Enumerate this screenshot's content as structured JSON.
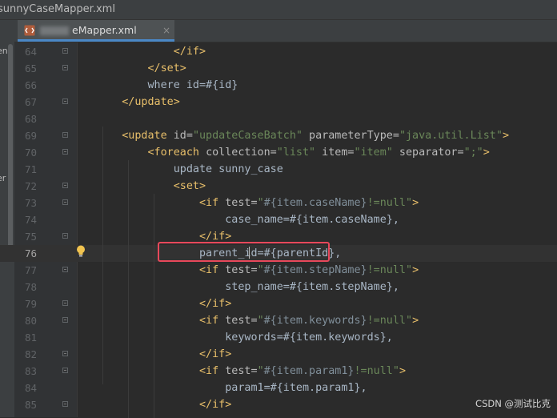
{
  "window": {
    "title": "sunnyCaseMapper.xml"
  },
  "left_panel": {
    "fragment_top": "ent",
    "fragment_mid": "er"
  },
  "tab": {
    "label_visible": "eMapper.xml",
    "icon": "xml-file-icon",
    "close": "×"
  },
  "editor": {
    "current_line": 76,
    "lines": [
      {
        "n": "64",
        "t": [
          {
            "c": "tag",
            "s": "            </if>"
          }
        ]
      },
      {
        "n": "65",
        "t": [
          {
            "c": "tag",
            "s": "        </set>"
          }
        ]
      },
      {
        "n": "66",
        "t": [
          {
            "c": "txt",
            "s": "        where id=#{id}"
          }
        ]
      },
      {
        "n": "67",
        "t": [
          {
            "c": "tag",
            "s": "    </update>"
          }
        ]
      },
      {
        "n": "68",
        "t": []
      },
      {
        "n": "69",
        "t": [
          {
            "c": "tag",
            "s": "    <update "
          },
          {
            "c": "attr",
            "s": "id="
          },
          {
            "c": "val",
            "s": "\"updateCaseBatch\""
          },
          {
            "c": "attr",
            "s": " parameterType="
          },
          {
            "c": "val",
            "s": "\"java.util.List\""
          },
          {
            "c": "tag",
            "s": ">"
          }
        ]
      },
      {
        "n": "70",
        "t": [
          {
            "c": "tag",
            "s": "        <foreach "
          },
          {
            "c": "attr",
            "s": "collection="
          },
          {
            "c": "val",
            "s": "\"list\""
          },
          {
            "c": "attr",
            "s": " item="
          },
          {
            "c": "val",
            "s": "\"item\""
          },
          {
            "c": "attr",
            "s": " separator="
          },
          {
            "c": "val",
            "s": "\";\""
          },
          {
            "c": "tag",
            "s": ">"
          }
        ]
      },
      {
        "n": "71",
        "t": [
          {
            "c": "txt",
            "s": "            update sunny_case"
          }
        ]
      },
      {
        "n": "72",
        "t": [
          {
            "c": "tag",
            "s": "            <set>"
          }
        ]
      },
      {
        "n": "73",
        "t": [
          {
            "c": "tag",
            "s": "                <if "
          },
          {
            "c": "attr",
            "s": "test="
          },
          {
            "c": "val",
            "s": "\""
          },
          {
            "c": "inner",
            "s": "#{item.caseName}"
          },
          {
            "c": "val",
            "s": "!=null\""
          },
          {
            "c": "tag",
            "s": ">"
          }
        ]
      },
      {
        "n": "74",
        "t": [
          {
            "c": "txt",
            "s": "                    case_name=#{item.caseName},"
          }
        ]
      },
      {
        "n": "75",
        "t": [
          {
            "c": "tag",
            "s": "                </if>"
          }
        ]
      },
      {
        "n": "76",
        "t": [
          {
            "c": "txt",
            "s": "                parent_id=#{parentId},"
          }
        ]
      },
      {
        "n": "77",
        "t": [
          {
            "c": "tag",
            "s": "                <if "
          },
          {
            "c": "attr",
            "s": "test="
          },
          {
            "c": "val",
            "s": "\""
          },
          {
            "c": "inner",
            "s": "#{item.stepName}"
          },
          {
            "c": "val",
            "s": "!=null\""
          },
          {
            "c": "tag",
            "s": ">"
          }
        ]
      },
      {
        "n": "78",
        "t": [
          {
            "c": "txt",
            "s": "                    step_name=#{item.stepName},"
          }
        ]
      },
      {
        "n": "79",
        "t": [
          {
            "c": "tag",
            "s": "                </if>"
          }
        ]
      },
      {
        "n": "80",
        "t": [
          {
            "c": "tag",
            "s": "                <if "
          },
          {
            "c": "attr",
            "s": "test="
          },
          {
            "c": "val",
            "s": "\""
          },
          {
            "c": "inner",
            "s": "#{item.keywords}"
          },
          {
            "c": "val",
            "s": "!=null\""
          },
          {
            "c": "tag",
            "s": ">"
          }
        ]
      },
      {
        "n": "81",
        "t": [
          {
            "c": "txt",
            "s": "                    keywords=#{item.keywords},"
          }
        ]
      },
      {
        "n": "82",
        "t": [
          {
            "c": "tag",
            "s": "                </if>"
          }
        ]
      },
      {
        "n": "83",
        "t": [
          {
            "c": "tag",
            "s": "                <if "
          },
          {
            "c": "attr",
            "s": "test="
          },
          {
            "c": "val",
            "s": "\""
          },
          {
            "c": "inner",
            "s": "#{item.param1}"
          },
          {
            "c": "val",
            "s": "!=null\""
          },
          {
            "c": "tag",
            "s": ">"
          }
        ]
      },
      {
        "n": "84",
        "t": [
          {
            "c": "txt",
            "s": "                    param1=#{item.param1},"
          }
        ]
      },
      {
        "n": "85",
        "t": [
          {
            "c": "tag",
            "s": "                </if>"
          }
        ]
      }
    ]
  },
  "watermark": "CSDN @测试比克",
  "colors": {
    "tag": "#e8bf6a",
    "attr": "#bababa",
    "value": "#6a8759",
    "text": "#a9b7c6",
    "highlight_box": "#e8485b",
    "tab_underline": "#4a88c7"
  }
}
